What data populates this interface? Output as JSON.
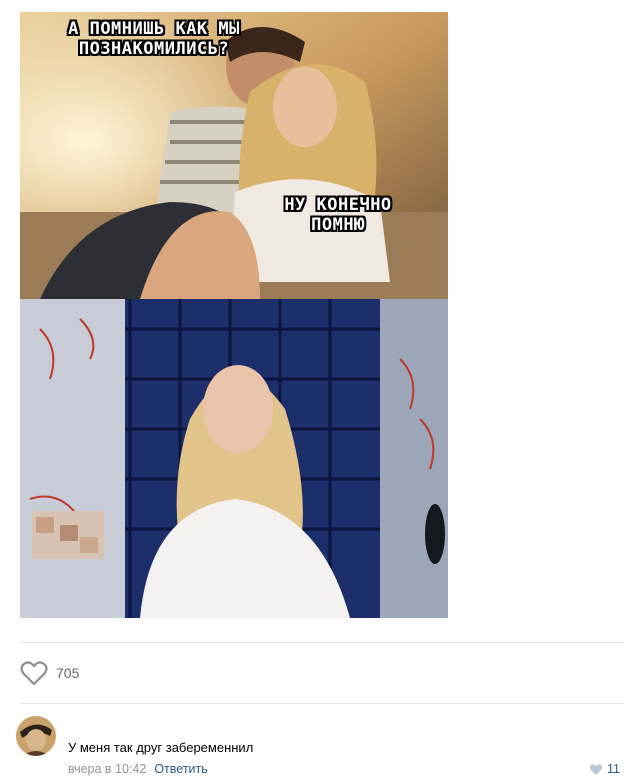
{
  "post": {
    "meme_top_text": "А ПОМНИШЬ КАК МЫ ПОЗНАКОМИЛИСЬ?",
    "meme_reply_text": "НУ КОНЕЧНО ПОМНЮ",
    "likes_count": "705"
  },
  "comment": {
    "text": "У меня так друг забеременнил",
    "time": "вчера в 10:42",
    "reply_label": "Ответить",
    "likes": "11"
  },
  "colors": {
    "link": "#2a5885",
    "meta": "#939393",
    "divider": "#e7e8ec"
  }
}
